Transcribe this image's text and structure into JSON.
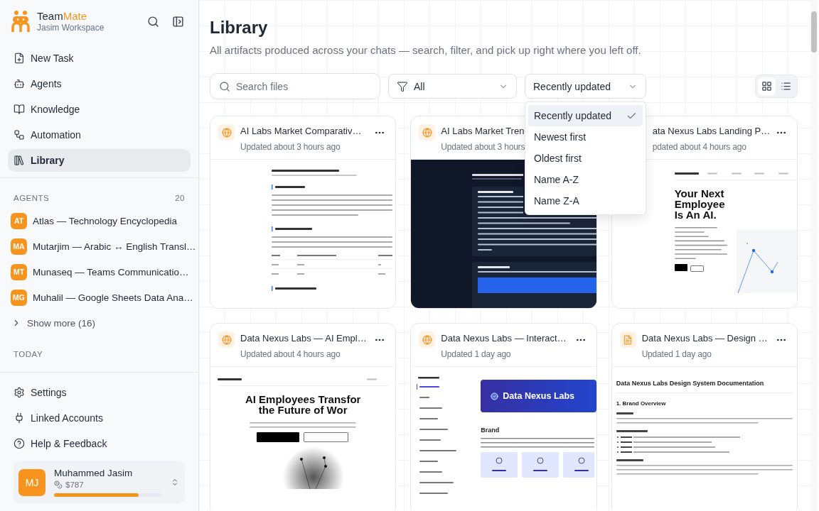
{
  "sidebar": {
    "brand": {
      "first": "Team",
      "second": "Mate"
    },
    "workspace": "Jasim Workspace",
    "nav": [
      {
        "label": "New Task",
        "selected": false
      },
      {
        "label": "Agents",
        "selected": false
      },
      {
        "label": "Knowledge",
        "selected": false
      },
      {
        "label": "Automation",
        "selected": false
      },
      {
        "label": "Library",
        "selected": true
      }
    ],
    "agents_heading": "AGENTS",
    "agents_count": "20",
    "agents": [
      {
        "initials": "AT",
        "name": "Atlas — Technology Encyclopedia"
      },
      {
        "initials": "MA",
        "name": "Mutarjim — Arabic ↔ English Transl…"
      },
      {
        "initials": "MT",
        "name": "Munaseq — Teams Communicatio…"
      },
      {
        "initials": "MG",
        "name": "Muhalil — Google Sheets Data Ana…"
      }
    ],
    "show_more": "Show more (16)",
    "today_heading": "TODAY",
    "footer": [
      {
        "label": "Settings"
      },
      {
        "label": "Linked Accounts"
      },
      {
        "label": "Help & Feedback"
      }
    ],
    "user": {
      "initials": "MJ",
      "name": "Muhammed Jasim",
      "credits": "$787",
      "level": 0.78
    }
  },
  "main": {
    "title": "Library",
    "subtitle": "All artifacts produced across your chats — search, filter, and pick up right where you left off.",
    "search": {
      "placeholder": "Search files"
    },
    "filter": {
      "value": "All"
    },
    "sort": {
      "value": "Recently updated",
      "open": true,
      "options": [
        {
          "label": "Recently updated",
          "selected": true
        },
        {
          "label": "Newest first",
          "selected": false
        },
        {
          "label": "Oldest first",
          "selected": false
        },
        {
          "label": "Name A-Z",
          "selected": false
        },
        {
          "label": "Name Z-A",
          "selected": false
        }
      ]
    },
    "view": [
      {
        "kind": "grid",
        "selected": true
      },
      {
        "kind": "list",
        "selected": false
      }
    ],
    "cards": [
      {
        "title": "AI Labs Market Comparativ…",
        "updated": "Updated about 3 hours ago",
        "kind": "web",
        "menu": true,
        "preview": {
          "kind": "report"
        }
      },
      {
        "title": "AI Labs Market Tren",
        "updated": "Updated about 3 hours",
        "kind": "web",
        "menu": false,
        "preview": {
          "kind": "dark-report"
        }
      },
      {
        "title": "ata Nexus Labs Landing P…",
        "updated": "pdated about 4 hours ago",
        "menu": true,
        "preview": {
          "kind": "landing",
          "headline": [
            "Your Next",
            "Employee",
            "Is An AI."
          ]
        }
      },
      {
        "title": "Data Nexus Labs — AI Empl…",
        "updated": "Updated about 4 hours ago",
        "kind": "web",
        "menu": true,
        "preview": {
          "kind": "site",
          "headline": [
            "AI Employees Transfor",
            "the Future of Wor"
          ]
        }
      },
      {
        "title": "Data Nexus Labs — Interact…",
        "updated": "Updated 1 day ago",
        "kind": "web",
        "menu": true,
        "preview": {
          "kind": "spec",
          "banner": "Data Nexus Labs",
          "heading": "Brand"
        }
      },
      {
        "title": "Data Nexus Labs — Design …",
        "updated": "Updated 1 day ago",
        "kind": "document",
        "menu": true,
        "preview": {
          "kind": "document",
          "heading": "Data Nexus Labs Design System Documentation",
          "subheading": "1. Brand Overview"
        }
      }
    ]
  }
}
